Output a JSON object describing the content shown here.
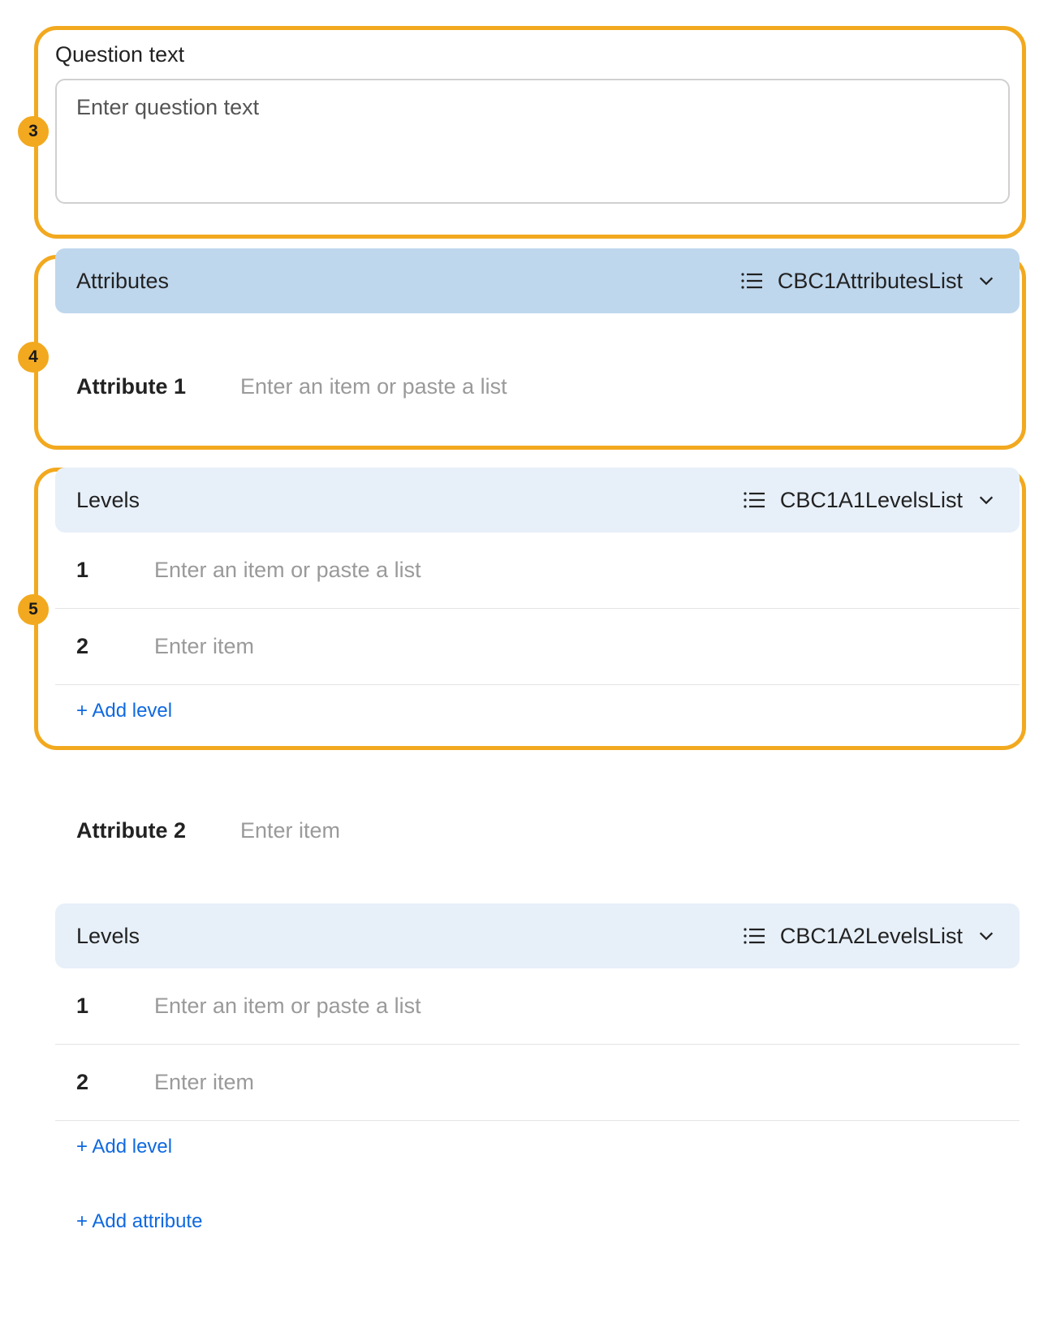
{
  "badges": {
    "b3": "3",
    "b4": "4",
    "b5": "5"
  },
  "question": {
    "label": "Question text",
    "placeholder": "Enter question text"
  },
  "attributes_header": {
    "title": "Attributes",
    "list_name": "CBC1AttributesList"
  },
  "attr1": {
    "label": "Attribute 1",
    "placeholder": "Enter an item or paste a list",
    "levels_header": {
      "title": "Levels",
      "list_name": "CBC1A1LevelsList"
    },
    "levels": [
      {
        "num": "1",
        "placeholder": "Enter an item or paste a list"
      },
      {
        "num": "2",
        "placeholder": "Enter item"
      }
    ],
    "add_level_label": "+ Add level"
  },
  "attr2": {
    "label": "Attribute 2",
    "placeholder": "Enter item",
    "levels_header": {
      "title": "Levels",
      "list_name": "CBC1A2LevelsList"
    },
    "levels": [
      {
        "num": "1",
        "placeholder": "Enter an item or paste a list"
      },
      {
        "num": "2",
        "placeholder": "Enter item"
      }
    ],
    "add_level_label": "+ Add level"
  },
  "add_attribute_label": "+ Add attribute"
}
